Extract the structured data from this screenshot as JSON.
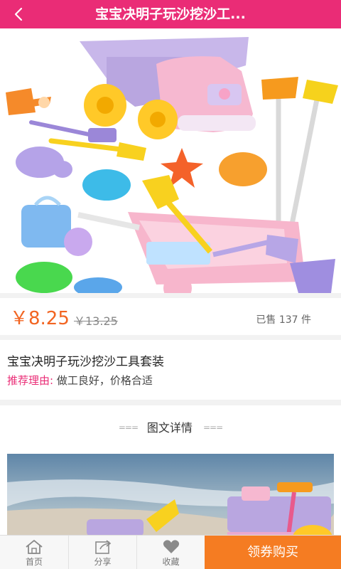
{
  "header": {
    "title": "宝宝决明子玩沙挖沙工...",
    "back_icon": "chevron-left-icon",
    "background": "#ea2c76"
  },
  "product": {
    "price": "￥8.25",
    "original_price": "￥13.25",
    "sold": "已售 137 件",
    "name": "宝宝决明子玩沙挖沙工具套装",
    "reason_label": "推荐理由:",
    "reason_text": "做工良好，价格合适",
    "price_color": "#f26522"
  },
  "detail": {
    "heading": "图文详情"
  },
  "tabbar": {
    "home": "首页",
    "share": "分享",
    "favorite": "收藏",
    "buy": "领券购买",
    "buy_color": "#f57c22"
  }
}
